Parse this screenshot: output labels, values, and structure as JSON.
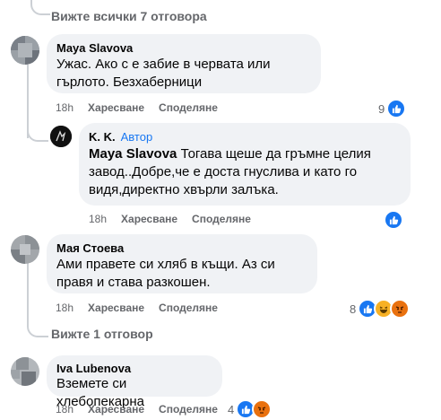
{
  "top_link": {
    "label": "Вижте всички 7 отговора"
  },
  "comments": [
    {
      "author": "Maya Slavova",
      "text": "Ужас. Ако с е забие в червата или гърлото. Безхаберници",
      "time": "18h",
      "like_label": "Харесване",
      "share_label": "Споделяне",
      "reaction_count": "9"
    },
    {
      "author": "K. K.",
      "badge": "Автор",
      "mention": "Maya Slavova",
      "text": " Тогава щеше да гръмне целия завод..Добре,че е доста гнуслива и като го видя,директно хвърли залъка.",
      "time": "18h",
      "like_label": "Харесване",
      "share_label": "Споделяне",
      "reaction_count": ""
    },
    {
      "author": "Мая Стоева",
      "text": "Ами правете си хляб в къщи. Аз си правя и става разкошен.",
      "time": "18h",
      "like_label": "Харесване",
      "share_label": "Споделяне",
      "reaction_count": "8"
    },
    {
      "author": "Iva Lubenova",
      "text": "Вземете си хлебопекарна",
      "time": "18h",
      "like_label": "Харесване",
      "share_label": "Споделяне",
      "reaction_count": "4"
    }
  ],
  "view_one_reply": {
    "label": "Вижте 1 отговор"
  },
  "colors": {
    "accent": "#1877f2",
    "bubble": "#f0f2f5",
    "meta": "#65676b",
    "like": "#1877f2",
    "haha": "#f7b125",
    "angry": "#e9710f"
  }
}
